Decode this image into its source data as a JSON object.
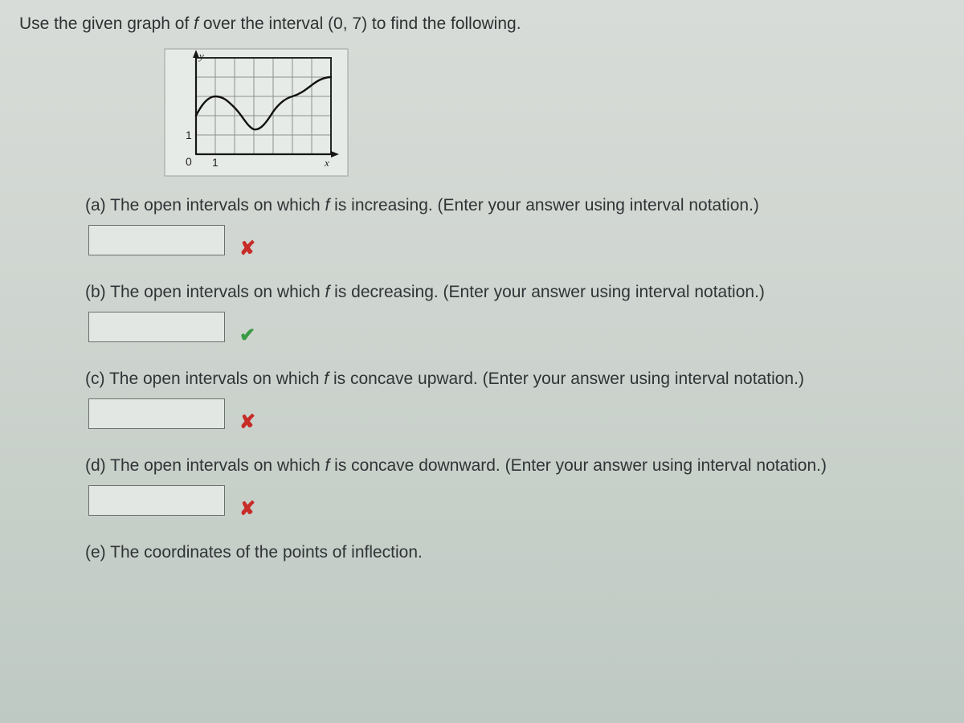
{
  "prompt": {
    "pre": "Use the given graph of ",
    "fvar": "f",
    "post": " over the interval (0, 7) to find the following."
  },
  "chart_data": {
    "type": "line",
    "title": "",
    "xlabel": "x",
    "ylabel": "y",
    "xlim": [
      0,
      7
    ],
    "ylim": [
      0,
      4
    ],
    "x_ticks": [
      0,
      1
    ],
    "y_ticks": [
      1
    ],
    "series": [
      {
        "name": "f",
        "x": [
          0,
          1,
          2,
          3,
          4,
          5,
          6,
          7
        ],
        "values": [
          2.0,
          3.0,
          2.4,
          1.3,
          2.2,
          3.0,
          3.6,
          4.0
        ]
      }
    ]
  },
  "questions": {
    "a": {
      "label": "(a)",
      "text_pre": "The open intervals on which ",
      "fvar": "f",
      "text_post": " is increasing. (Enter your answer using interval notation.)",
      "value": "",
      "status": "wrong"
    },
    "b": {
      "label": "(b)",
      "text_pre": "The open intervals on which ",
      "fvar": "f",
      "text_post": " is decreasing. (Enter your answer using interval notation.)",
      "value": "",
      "status": "correct"
    },
    "c": {
      "label": "(c)",
      "text_pre": "The open intervals on which ",
      "fvar": "f",
      "text_post": " is concave upward. (Enter your answer using interval notation.)",
      "value": "",
      "status": "wrong"
    },
    "d": {
      "label": "(d)",
      "text_pre": "The open intervals on which ",
      "fvar": "f",
      "text_post": " is concave downward. (Enter your answer using interval notation.)",
      "value": "",
      "status": "wrong"
    },
    "e": {
      "label": "(e)",
      "text": "The coordinates of the points of inflection."
    }
  },
  "icons": {
    "wrong": "✘",
    "correct": "✔"
  },
  "graph_labels": {
    "y": "y",
    "x": "x",
    "zero": "0",
    "one_x": "1",
    "one_y": "1"
  }
}
